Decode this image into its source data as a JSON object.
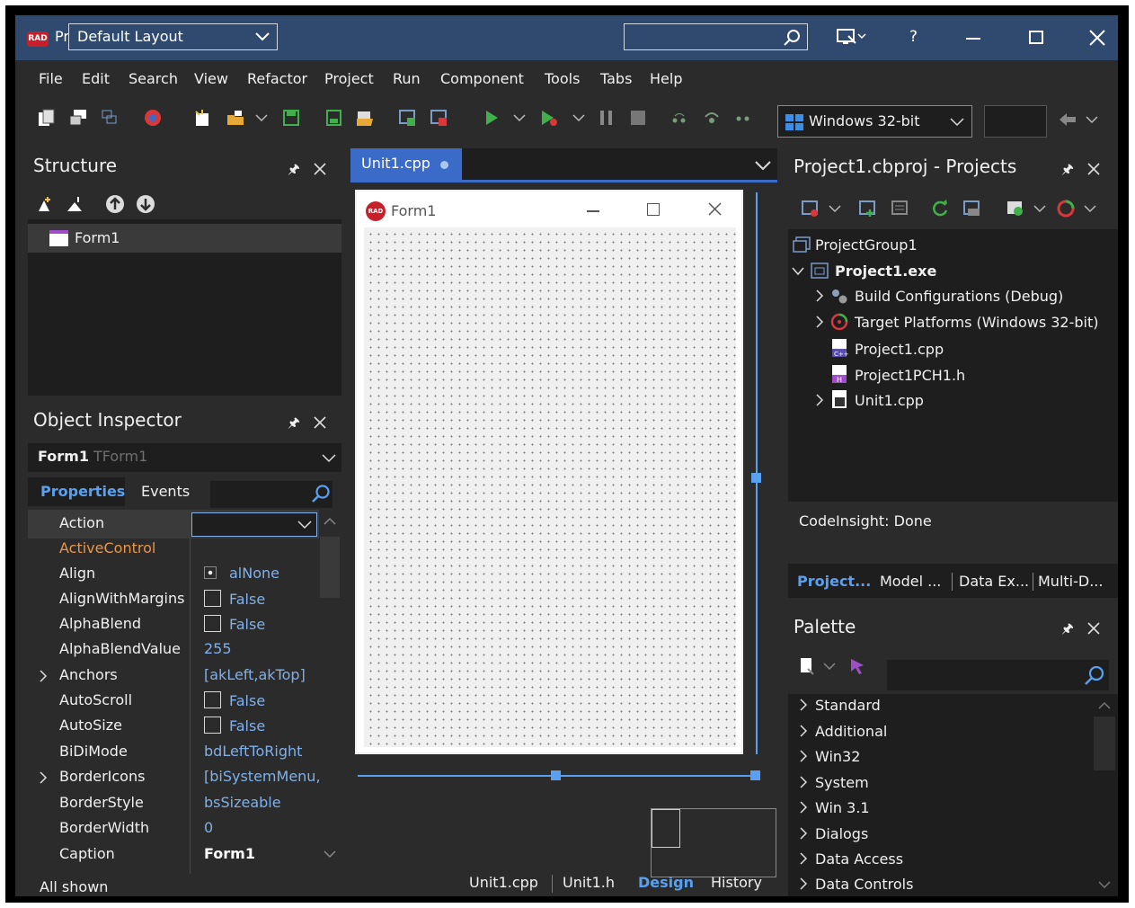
{
  "title_bar": {
    "app_abbr": "RAD",
    "app_title_partial": "Pr",
    "layout_selector": "Default Layout",
    "help_glyph": "?"
  },
  "menu": [
    "File",
    "Edit",
    "Search",
    "View",
    "Refactor",
    "Project",
    "Run",
    "Component",
    "Tools",
    "Tabs",
    "Help"
  ],
  "toolbar": {
    "platform_selector": "Windows 32-bit"
  },
  "structure": {
    "title": "Structure",
    "tree_root": "Form1"
  },
  "object_inspector": {
    "title": "Object Inspector",
    "object_name": "Form1",
    "object_type": "TForm1",
    "tabs": [
      "Properties",
      "Events"
    ],
    "properties": [
      {
        "name": "Action",
        "value": ""
      },
      {
        "name": "ActiveControl",
        "value": ""
      },
      {
        "name": "Align",
        "value": "alNone"
      },
      {
        "name": "AlignWithMargins",
        "value": "False"
      },
      {
        "name": "AlphaBlend",
        "value": "False"
      },
      {
        "name": "AlphaBlendValue",
        "value": "255"
      },
      {
        "name": "Anchors",
        "value": "[akLeft,akTop]"
      },
      {
        "name": "AutoScroll",
        "value": "False"
      },
      {
        "name": "AutoSize",
        "value": "False"
      },
      {
        "name": "BiDiMode",
        "value": "bdLeftToRight"
      },
      {
        "name": "BorderIcons",
        "value": "[biSystemMenu,"
      },
      {
        "name": "BorderStyle",
        "value": "bsSizeable"
      },
      {
        "name": "BorderWidth",
        "value": "0"
      },
      {
        "name": "Caption",
        "value": "Form1"
      }
    ],
    "status": "All shown"
  },
  "editor": {
    "file_tab": "Unit1.cpp",
    "form_caption": "Form1",
    "form_icon_text": "RAD",
    "bottom_tabs": [
      "Unit1.cpp",
      "Unit1.h",
      "Design",
      "History"
    ],
    "active_bottom_tab": "Design"
  },
  "projects": {
    "title": "Project1.cbproj - Projects",
    "tree": [
      {
        "label": "ProjectGroup1",
        "level": 0
      },
      {
        "label": "Project1.exe",
        "level": 0
      },
      {
        "label": "Build Configurations (Debug)",
        "level": 1
      },
      {
        "label": "Target Platforms (Windows 32-bit)",
        "level": 1
      },
      {
        "label": "Project1.cpp",
        "level": 1
      },
      {
        "label": "Project1PCH1.h",
        "level": 1
      },
      {
        "label": "Unit1.cpp",
        "level": 1
      }
    ],
    "status": "CodeInsight: Done",
    "tabs": [
      "Project...",
      "Model ...",
      "Data Ex...",
      "Multi-D..."
    ]
  },
  "palette": {
    "title": "Palette",
    "categories": [
      "Standard",
      "Additional",
      "Win32",
      "System",
      "Win 3.1",
      "Dialogs",
      "Data Access",
      "Data Controls"
    ]
  },
  "colors": {
    "title_bar": "#2f4a6e",
    "accent": "#5aa0f0",
    "link_value": "#7fb0ea",
    "active_control": "#e8964a",
    "rad_logo": "#c8202a"
  }
}
